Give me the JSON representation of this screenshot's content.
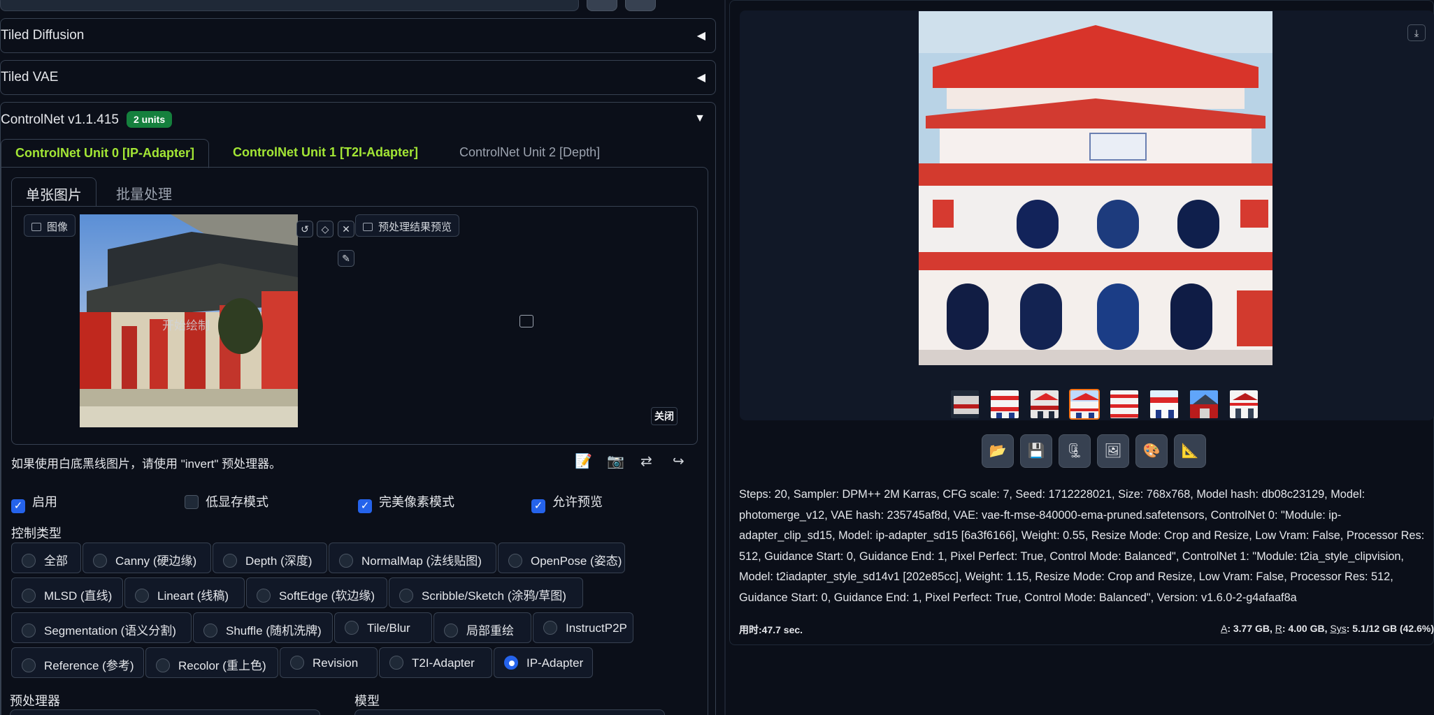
{
  "accordions": {
    "tiled_diffusion": "Tiled Diffusion",
    "tiled_vae": "Tiled VAE",
    "collapsed_arrow": "◀",
    "expanded_arrow": "▼"
  },
  "controlnet": {
    "title": "ControlNet v1.1.415",
    "badge": "2 units",
    "unit_tabs": [
      "ControlNet Unit 0 [IP-Adapter]",
      "ControlNet Unit 1 [T2I-Adapter]",
      "ControlNet Unit 2 [Depth]"
    ],
    "sub_tabs": [
      "单张图片",
      "批量处理"
    ],
    "image_label": "图像",
    "preview_label": "预处理结果预览",
    "overlay_text": "开始绘制",
    "close_label": "关闭",
    "hint": "如果使用白底黑线图片，请使用 \"invert\" 预处理器。",
    "checkboxes": [
      {
        "label": "启用",
        "checked": true
      },
      {
        "label": "低显存模式",
        "checked": false
      },
      {
        "label": "完美像素模式",
        "checked": true
      },
      {
        "label": "允许预览",
        "checked": true
      }
    ],
    "control_type_label": "控制类型",
    "control_types": [
      [
        "全部",
        "Canny (硬边缘)",
        "Depth (深度)",
        "NormalMap (法线贴图)",
        "OpenPose (姿态)"
      ],
      [
        "MLSD (直线)",
        "Lineart (线稿)",
        "SoftEdge (软边缘)",
        "Scribble/Sketch (涂鸦/草图)"
      ],
      [
        "Segmentation (语义分割)",
        "Shuffle (随机洗牌)",
        "Tile/Blur",
        "局部重绘",
        "InstructP2P"
      ],
      [
        "Reference (参考)",
        "Recolor (重上色)",
        "Revision",
        "T2I-Adapter",
        "IP-Adapter"
      ]
    ],
    "selected_type": "IP-Adapter",
    "preprocessor_label": "预处理器",
    "model_label": "模型"
  },
  "output": {
    "info": "Steps: 20, Sampler: DPM++ 2M Karras, CFG scale: 7, Seed: 1712228021, Size: 768x768, Model hash: db08c23129, Model: photomerge_v12, VAE hash: 235745af8d, VAE: vae-ft-mse-840000-ema-pruned.safetensors, ControlNet 0: \"Module: ip-adapter_clip_sd15, Model: ip-adapter_sd15 [6a3f6166], Weight: 0.55, Resize Mode: Crop and Resize, Low Vram: False, Processor Res: 512, Guidance Start: 0, Guidance End: 1, Pixel Perfect: True, Control Mode: Balanced\", ControlNet 1: \"Module: t2ia_style_clipvision, Model: t2iadapter_style_sd14v1 [202e85cc], Weight: 1.15, Resize Mode: Crop and Resize, Low Vram: False, Processor Res: 512, Guidance Start: 0, Guidance End: 1, Pixel Perfect: True, Control Mode: Balanced\", Version: v1.6.0-2-g4afaaf8a",
    "timing_label": "用时:",
    "timing_value": "47.7 sec.",
    "vram_a_key": "A",
    "vram_a": ": 3.77 GB, ",
    "vram_r_key": "R",
    "vram_r": ": 4.00 GB, ",
    "vram_sys_key": "Sys",
    "vram_sys": ": 5.1/12 GB (42.6%)",
    "selected_thumb_index": 3
  }
}
